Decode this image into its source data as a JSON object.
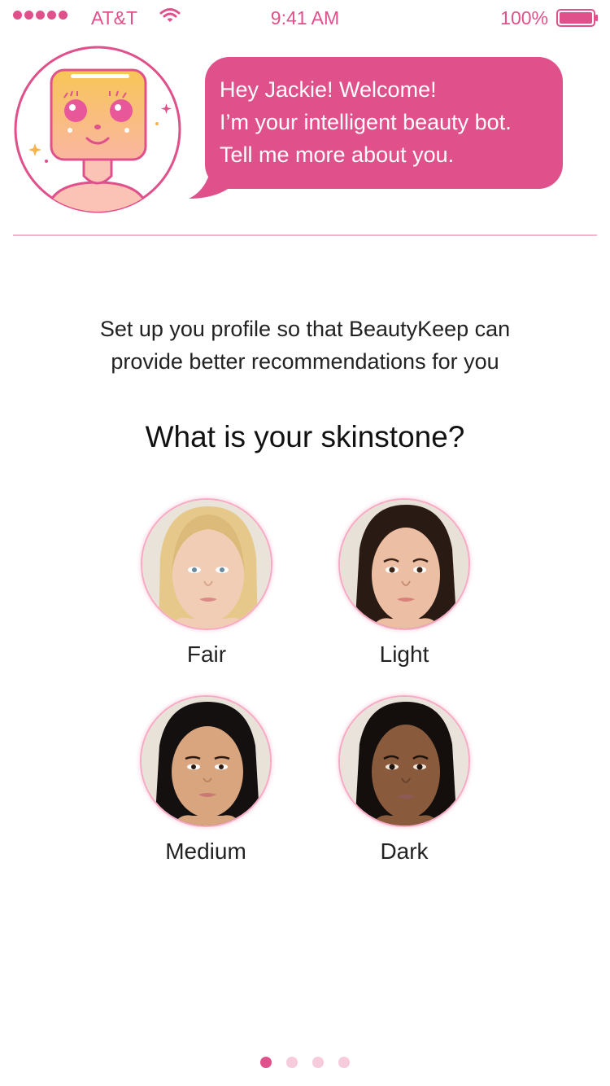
{
  "status_bar": {
    "carrier": "AT&T",
    "time": "9:41 AM",
    "battery": "100%",
    "signal_icon": "signal-dots-icon",
    "wifi_icon": "wifi-icon",
    "battery_icon": "battery-icon"
  },
  "bot": {
    "avatar_icon": "beauty-bot-avatar-icon",
    "message": "Hey Jackie! Welcome!\nI’m your intelligent beauty bot.\nTell me more about you."
  },
  "intro": "Set up you profile so that BeautyKeep can\nprovide better recommendations for you",
  "question": "What is your skinstone?",
  "options": [
    {
      "label": "Fair",
      "image": "fair-skin-face"
    },
    {
      "label": "Light",
      "image": "light-skin-face"
    },
    {
      "label": "Medium",
      "image": "medium-skin-face"
    },
    {
      "label": "Dark",
      "image": "dark-skin-face"
    }
  ],
  "pager": {
    "pages": 4,
    "current": 1
  },
  "colors": {
    "accent": "#e0508a",
    "divider": "#f3b5cc",
    "pager_inactive": "#f6cbdb"
  }
}
